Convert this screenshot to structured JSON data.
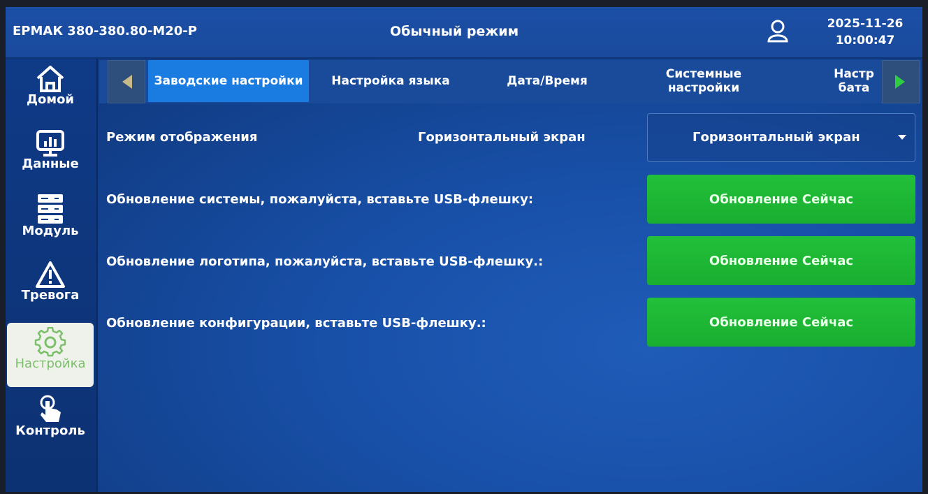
{
  "header": {
    "model": "ЕРМАК 380-380.80-М20-Р",
    "mode": "Обычный режим",
    "date": "2025-11-26",
    "time": "10:00:47"
  },
  "sidebar": {
    "items": [
      {
        "label": "Домой",
        "icon": "home-icon"
      },
      {
        "label": "Данные",
        "icon": "monitor-chart-icon"
      },
      {
        "label": "Модуль",
        "icon": "server-rack-icon"
      },
      {
        "label": "Тревога",
        "icon": "warning-icon"
      },
      {
        "label": "Настройка",
        "icon": "gear-icon",
        "active": true
      },
      {
        "label": "Контроль",
        "icon": "touch-hand-icon"
      }
    ]
  },
  "tabs": [
    {
      "label": "Заводские настройки",
      "active": true
    },
    {
      "label": "Настройка языка"
    },
    {
      "label": "Дата/Время"
    },
    {
      "label": "Системные настройки"
    },
    {
      "label": "Настр бата"
    }
  ],
  "settings": {
    "display_mode_label": "Режим отображения",
    "display_mode_value": "Горизонтальный экран",
    "display_mode_selected": "Горизонтальный экран",
    "system_update_label": "Обновление системы, пожалуйста, вставьте USB-флешку:",
    "logo_update_label": "Обновление логотипа, пожалуйста, вставьте USB-флешку.:",
    "config_update_label": "Обновление конфигурации, вставьте USB-флешку.:",
    "update_button_label": "Обновление Сейчас"
  },
  "colors": {
    "accent_green": "#1fb836",
    "active_tab": "#1a7be0",
    "active_nav_text": "#7bbf6a"
  }
}
